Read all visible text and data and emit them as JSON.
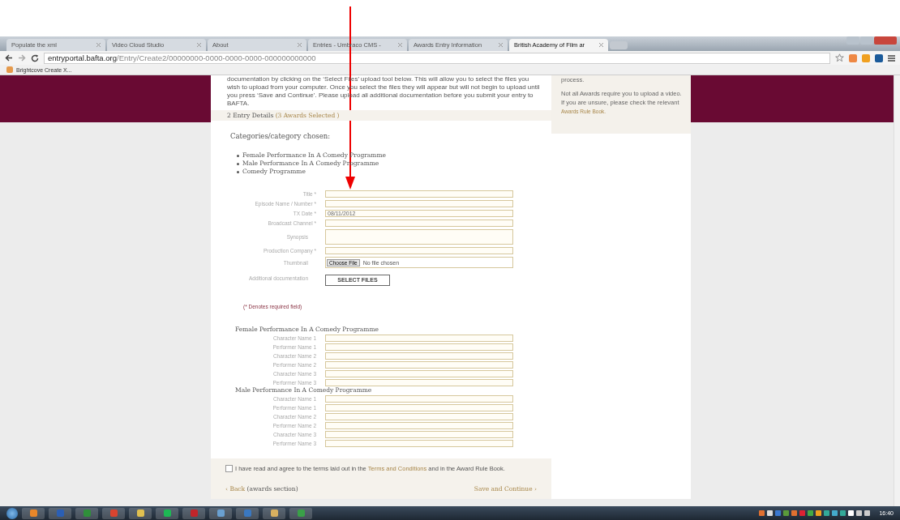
{
  "browser": {
    "tabs": [
      {
        "title": "Populate the xml",
        "selected": false
      },
      {
        "title": "Video Cloud Studio",
        "selected": false
      },
      {
        "title": "About",
        "selected": false
      },
      {
        "title": "Entries - Umbraco CMS - ",
        "selected": false
      },
      {
        "title": "Awards Entry Information",
        "selected": false
      },
      {
        "title": "British Academy of Film ar",
        "selected": true
      }
    ],
    "address": {
      "domain": "entryportal.bafta.org",
      "path": "/Entry/Create2/00000000-0000-0000-0000-000000000000"
    },
    "bookmarks": [
      "Brightcove Create X..."
    ]
  },
  "intro": "documentation by clicking on the ‘Select Files’ upload tool below. This will allow you to select the files you wish to upload from your computer. Once you select the files they will appear but will not begin to upload until you press ‘Save and Continue’. Please upload all additional documentation before you submit your entry to BAFTA.",
  "step": {
    "label": "2 Entry Details",
    "count": "(3 Awards Selected )"
  },
  "sidebar": {
    "paragraphs": [
      {
        "text": "process."
      },
      {
        "text": "Not all Awards require you to upload a video. If you are unsure, please check the relevant ",
        "link": "Awards Rule Book."
      }
    ]
  },
  "categories": {
    "heading": "Categories/category chosen:",
    "items": [
      "Female Performance In A Comedy Programme",
      "Male Performance In A Comedy Programme",
      "Comedy Programme"
    ]
  },
  "fields": [
    {
      "kind": "text",
      "label": "Title *"
    },
    {
      "kind": "text",
      "label": "Episode Name / Number *"
    },
    {
      "kind": "text",
      "label": "TX Date *",
      "value": "08/11/2012"
    },
    {
      "kind": "text",
      "label": "Broadcast Channel *"
    },
    {
      "kind": "textarea",
      "label": "Synopsis"
    },
    {
      "kind": "text",
      "label": "Production Company *"
    },
    {
      "kind": "file",
      "label": "Thumbnail",
      "button": "Choose File",
      "status": "No file chosen"
    },
    {
      "kind": "upload",
      "label": "Additional documentation",
      "button": "SELECT FILES"
    }
  ],
  "required_note": "(* Denotes required field)",
  "award_sections": [
    {
      "title": "Female Performance In A Comedy Programme",
      "fields": [
        "Character Name 1",
        "Performer Name 1",
        "Character Name 2",
        "Performer Name 2",
        "Character Name 3",
        "Performer Name 3"
      ]
    },
    {
      "title": "Male Performance In A Comedy Programme",
      "fields": [
        "Character Name 1",
        "Performer Name 1",
        "Character Name 2",
        "Performer Name 2",
        "Character Name 3",
        "Performer Name 3"
      ]
    }
  ],
  "terms": {
    "checked": false,
    "before": "I have read and agree to the terms laid out in the ",
    "link": "Terms and Conditions",
    "after": " and in the Award Rule Book."
  },
  "nav": {
    "back": "‹ Back",
    "back_note": "(awards section)",
    "next": "Save and Continue ›"
  },
  "taskbar": {
    "clock": "16:40"
  }
}
